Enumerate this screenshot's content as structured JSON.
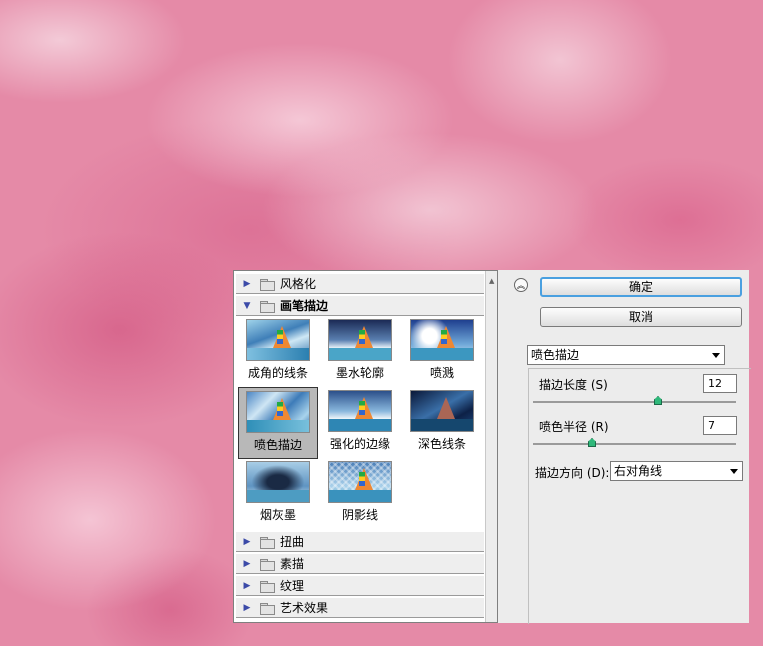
{
  "filter_gallery": {
    "categories_top": [
      {
        "label": "风格化",
        "expanded": false
      },
      {
        "label": "画笔描边",
        "expanded": true
      }
    ],
    "thumbnails": [
      {
        "label": "成角的线条"
      },
      {
        "label": "墨水轮廓"
      },
      {
        "label": "喷溅"
      },
      {
        "label": "喷色描边",
        "selected": true
      },
      {
        "label": "强化的边缘"
      },
      {
        "label": "深色线条"
      },
      {
        "label": "烟灰墨"
      },
      {
        "label": "阴影线"
      }
    ],
    "categories_bottom": [
      {
        "label": "扭曲"
      },
      {
        "label": "素描"
      },
      {
        "label": "纹理"
      },
      {
        "label": "艺术效果"
      }
    ]
  },
  "panel": {
    "ok_label": "确定",
    "cancel_label": "取消",
    "filter_select": "喷色描边",
    "params": [
      {
        "label": "描边长度 (S)",
        "value": "12",
        "level": 0.62
      },
      {
        "label": "喷色半径 (R)",
        "value": "7",
        "level": 0.28
      }
    ],
    "direction_label": "描边方向 (D):",
    "direction_value": "右对角线"
  }
}
